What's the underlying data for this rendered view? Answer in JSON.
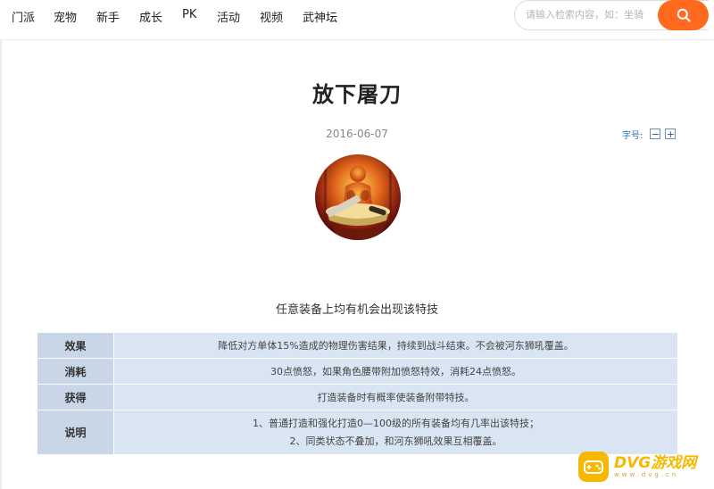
{
  "nav": {
    "items": [
      {
        "label": "门派"
      },
      {
        "label": "宠物"
      },
      {
        "label": "新手"
      },
      {
        "label": "成长"
      },
      {
        "label": "PK"
      },
      {
        "label": "活动"
      },
      {
        "label": "视频"
      },
      {
        "label": "武神坛"
      }
    ],
    "search_placeholder": "请输入检索内容，如：坐骑"
  },
  "article": {
    "title": "放下屠刀",
    "date": "2016-06-07",
    "font_size_label": "字号:",
    "decrease": "−",
    "increase": "+",
    "subtitle": "任意装备上均有机会出现该特技"
  },
  "table": {
    "rows": [
      {
        "key": "效果",
        "value": "降低对方单体15%造成的物理伤害结果，持续到战斗结束。不会被河东狮吼覆盖。"
      },
      {
        "key": "消耗",
        "value": "30点愤怒，如果角色腰带附加愤怒特效，消耗24点愤怒。"
      },
      {
        "key": "获得",
        "value": "打造装备时有概率使装备附带特技。"
      },
      {
        "key": "说明",
        "line1": "1、普通打造和强化打造0—100级的所有装备均有几率出该特技；",
        "line2": "2、同类状态不叠加，和河东狮吼效果互相覆盖。"
      }
    ]
  },
  "watermark": {
    "name": "DVG游戏网",
    "url": "www.dvg.cn"
  },
  "colors": {
    "accent": "#ff6a1e",
    "table_key_bg": "#c9d6e8",
    "table_value_bg": "#d9e5f3",
    "watermark": "#f6b800"
  },
  "icons": {
    "search": "search-icon",
    "skill": "skill-icon",
    "watermark_logo": "gamepad-icon"
  }
}
